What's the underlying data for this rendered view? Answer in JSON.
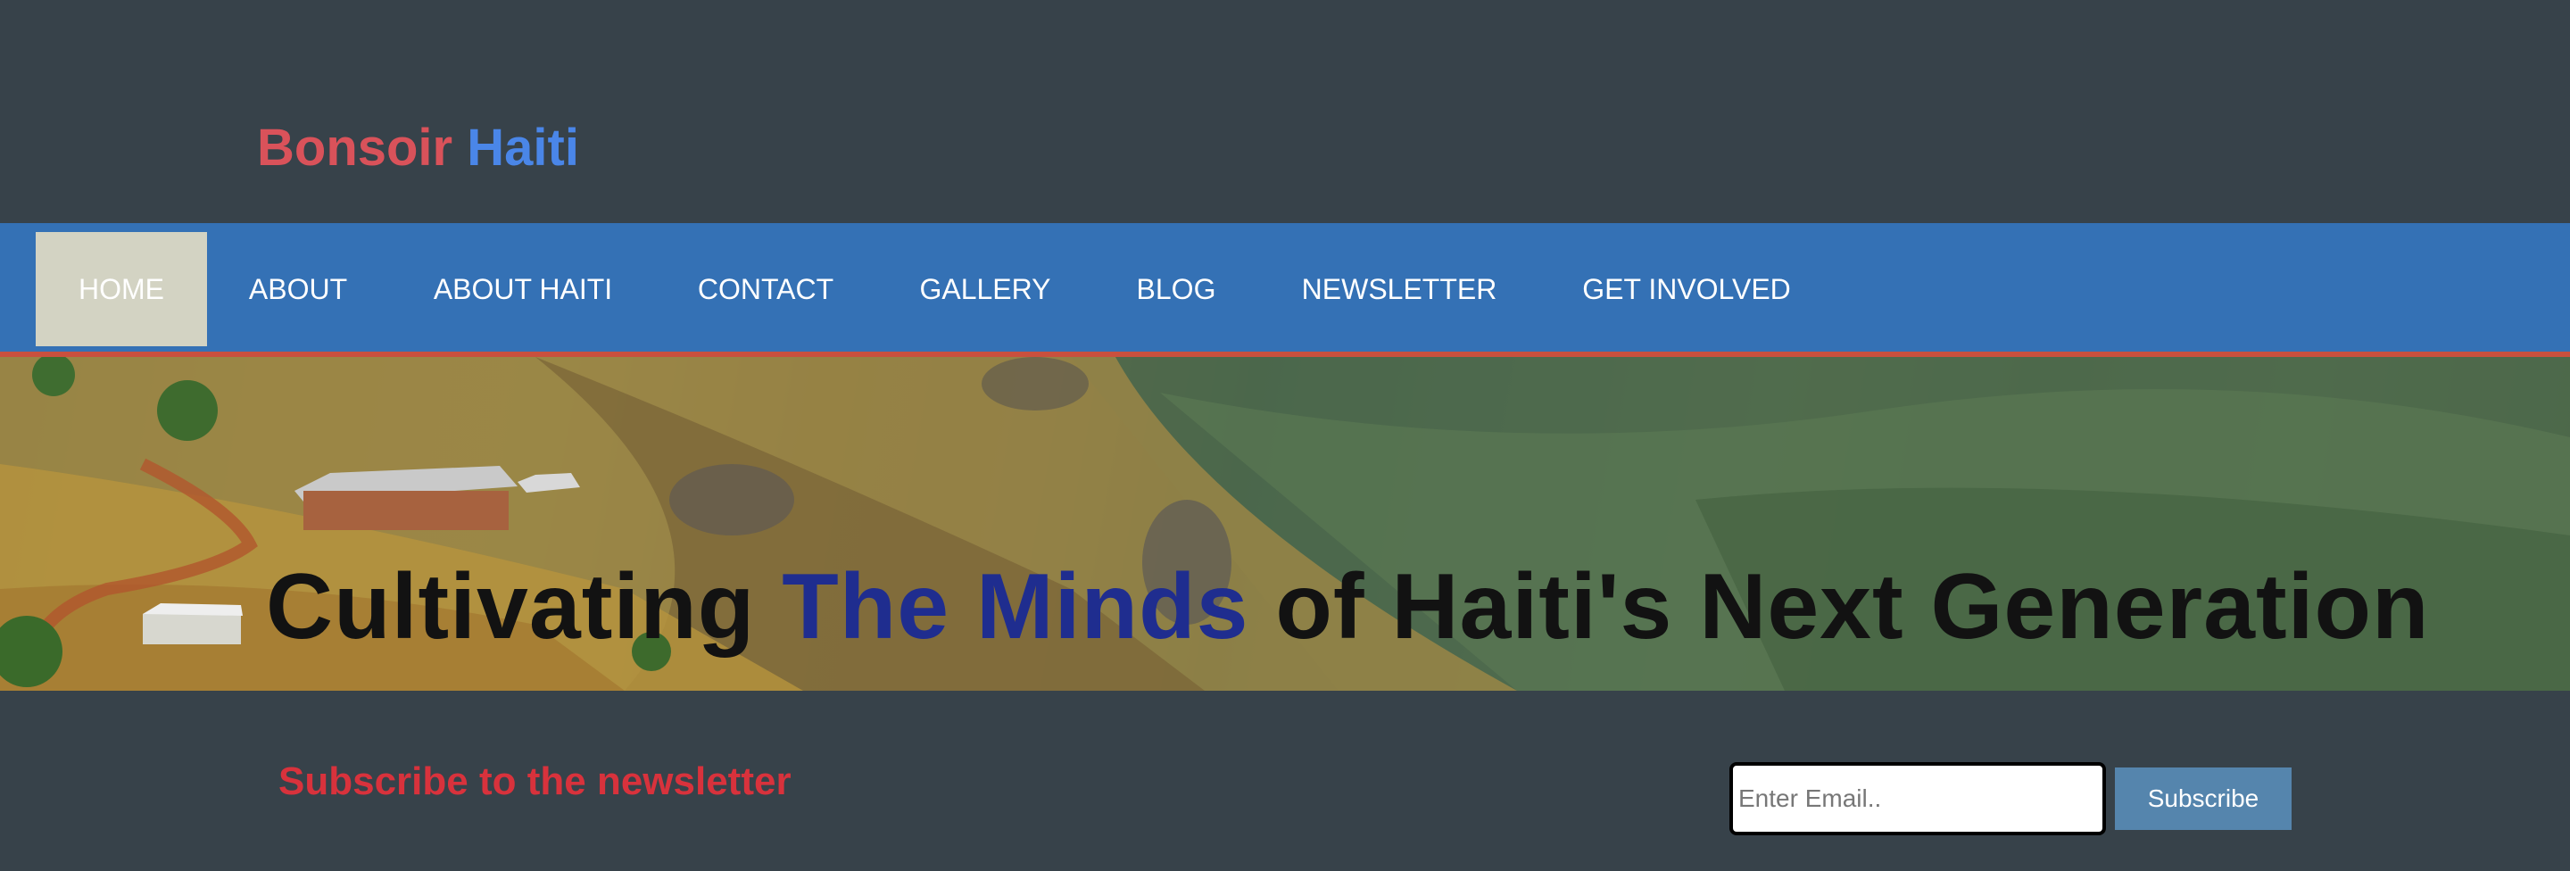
{
  "brand": {
    "word1": "Bonsoir",
    "word2": "Haiti"
  },
  "nav": {
    "items": [
      {
        "label": "HOME",
        "active": true
      },
      {
        "label": "ABOUT"
      },
      {
        "label": "ABOUT HAITI"
      },
      {
        "label": "CONTACT"
      },
      {
        "label": "GALLERY"
      },
      {
        "label": "BLOG"
      },
      {
        "label": "NEWSLETTER"
      },
      {
        "label": "GET INVOLVED"
      }
    ]
  },
  "hero": {
    "title_part1": "Cultivating ",
    "title_accent": "The Minds",
    "title_part2": " of Haiti's Next Generation"
  },
  "newsletter": {
    "title": "Subscribe to the newsletter",
    "email_placeholder": "Enter Email..",
    "email_value": "",
    "button_label": "Subscribe"
  },
  "colors": {
    "background": "#37424a",
    "nav": "#3471b5",
    "nav_active": "#d3d3c3",
    "nav_border": "#c9503e",
    "brand_red": "#d9525a",
    "brand_blue": "#4a86e8",
    "accent_navy": "#1f2d8f",
    "newsletter_title": "#d8323c",
    "button": "#5585ad"
  }
}
